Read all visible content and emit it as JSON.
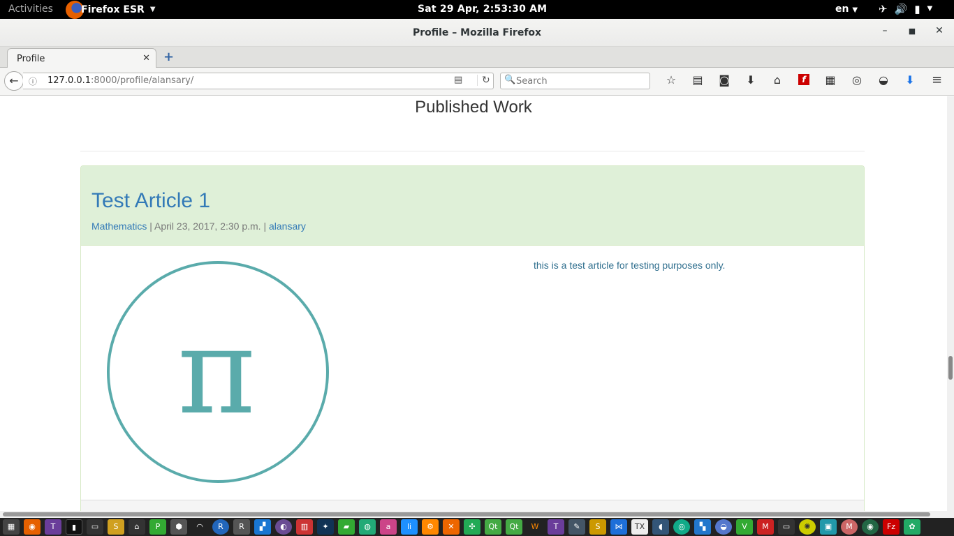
{
  "topbar": {
    "activities": "Activities",
    "app_name": "Firefox ESR",
    "clock": "Sat 29 Apr,  2:53:30 AM",
    "language": "en"
  },
  "window": {
    "title": "Profile – Mozilla Firefox"
  },
  "tabs": [
    {
      "label": "Profile"
    }
  ],
  "navbar": {
    "url_host": "127.0.0.1",
    "url_rest": ":8000/profile/alansary/",
    "search_placeholder": "Search"
  },
  "page": {
    "section_title": "Published Work",
    "article": {
      "title": "Test Article 1",
      "category": "Mathematics",
      "date": "April 23, 2017, 2:30 p.m.",
      "author": "alansary",
      "separator": "|",
      "summary": "this is a test article for testing purposes only.",
      "image_symbol": "π",
      "image_color": "#5aabab"
    }
  },
  "colors": {
    "panel_heading_bg": "#dff0d8",
    "link": "#337ab7",
    "summary_text": "#31708f"
  }
}
